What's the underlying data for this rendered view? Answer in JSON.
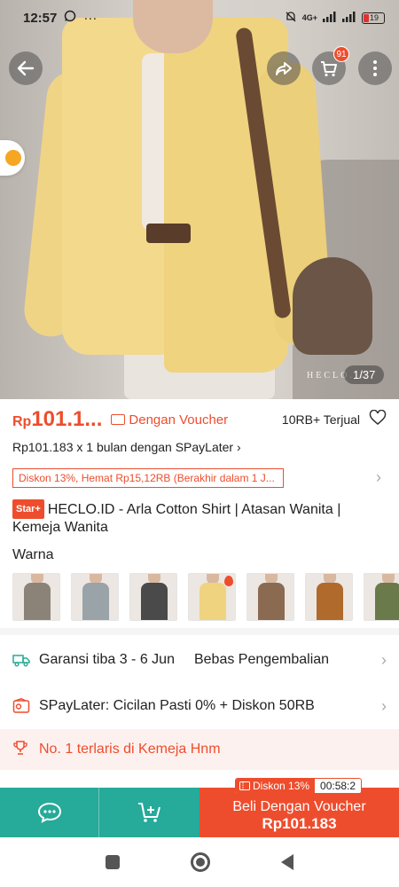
{
  "status_bar": {
    "time": "12:57",
    "battery": "19",
    "network": "4G+"
  },
  "gallery": {
    "counter": "1/37",
    "brand_mark": "HECLO.ID"
  },
  "header": {
    "cart_badge": "91"
  },
  "price": {
    "currency": "Rp",
    "amount": "101.1...",
    "voucher_label": "Dengan Voucher",
    "sold": "10RB+ Terjual"
  },
  "spaylater_line": "Rp101.183 x 1 bulan dengan SPayLater ›",
  "discount_banner": "Diskon 13%, Hemat Rp15,12RB (Berakhir dalam 1 J...",
  "product": {
    "badge": "Star+",
    "title": "HECLO.ID - Arla Cotton Shirt | Atasan Wanita | Kemeja Wanita"
  },
  "variants": {
    "label": "Warna",
    "swatch_colors": [
      "#8c8378",
      "#9aa3a8",
      "#4a4a4a",
      "#efd37f",
      "#8b6a52",
      "#b06a2c",
      "#6b7a4a"
    ]
  },
  "shipping": {
    "label": "Garansi tiba 3 - 6 Jun",
    "returns": "Bebas Pengembalian"
  },
  "spaylater_promo": "SPayLater: Cicilan Pasti 0% + Diskon 50RB",
  "bestseller": "No. 1 terlaris di Kemeja Hnm",
  "bottom_bar": {
    "buy_line1": "Beli Dengan Voucher",
    "buy_line2": "Rp101.183",
    "timer_discount": "Diskon 13%",
    "timer": "00:58:2"
  },
  "colors": {
    "accent": "#ee4d2d",
    "teal": "#26aa99"
  }
}
